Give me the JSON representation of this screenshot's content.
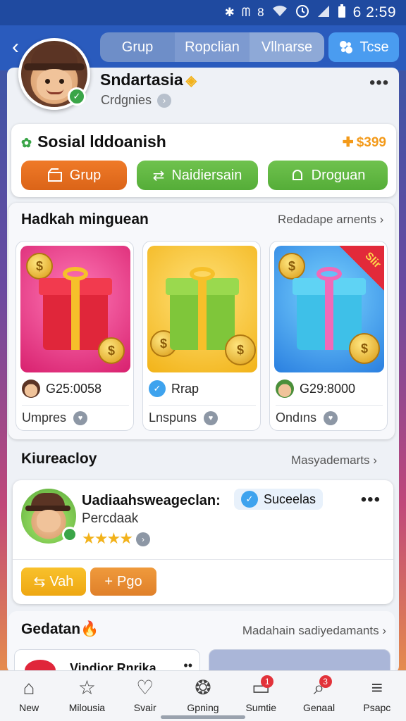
{
  "status_bar": {
    "icons": [
      "bluetooth-icon",
      "vibrate-icon",
      "wifi-icon",
      "alarm-icon",
      "signal-icon",
      "battery-icon"
    ],
    "glyph1": "✱",
    "glyph2": "ᗰ",
    "glyph3": "8",
    "time": "6 2:59"
  },
  "header": {
    "tabs": [
      {
        "label": "Grup"
      },
      {
        "label": "Ropclian"
      },
      {
        "label": "Vllnarse"
      }
    ],
    "action_label": "Tcse"
  },
  "profile": {
    "name": "Sndartasia",
    "subtitle": "Crdgnies"
  },
  "social": {
    "title": "Sosial lddoanish",
    "price": "$399",
    "buttons": [
      {
        "label": "Grup"
      },
      {
        "label": "Naidiersain"
      },
      {
        "label": "Droguan"
      }
    ]
  },
  "gifts_section": {
    "title": "Hadkah minguean",
    "link": "Redadape arnents",
    "cards": [
      {
        "price": "G25:0058",
        "footer": "Umpres",
        "sale": ""
      },
      {
        "price": "Rrap",
        "footer": "Lnspuns",
        "sale": ""
      },
      {
        "price": "G29:8000",
        "footer": "Ondıns",
        "sale": "Slir"
      }
    ]
  },
  "friends_section": {
    "title": "Kiureacloy",
    "link": "Masyademarts",
    "friend": {
      "name": "Uadiaahsweageclan:",
      "subtitle": "Percdaak",
      "tag": "Suceelas",
      "rating": 4,
      "buttons": [
        {
          "label": "Vah"
        },
        {
          "label": "Pgo"
        }
      ]
    }
  },
  "gedatan_section": {
    "title": "Gedatan",
    "link": "Madahain sadiyedamants",
    "preview_title": "Vindior Rnrika"
  },
  "bottom_nav": [
    {
      "label": "New",
      "icon": "home-icon",
      "badge": ""
    },
    {
      "label": "Milousia",
      "icon": "star-icon",
      "badge": ""
    },
    {
      "label": "Svair",
      "icon": "heart-icon",
      "badge": ""
    },
    {
      "label": "Gpning",
      "icon": "wheel-icon",
      "badge": ""
    },
    {
      "label": "Sumtie",
      "icon": "chat-icon",
      "badge": "1"
    },
    {
      "label": "Genaal",
      "icon": "search-icon",
      "badge": "3"
    },
    {
      "label": "Psapc",
      "icon": "menu-icon",
      "badge": ""
    }
  ],
  "colors": {
    "header": "#2a5bbd",
    "orange": "#ef7a28",
    "green": "#6fc24e",
    "accent_blue": "#4a9cf0"
  }
}
